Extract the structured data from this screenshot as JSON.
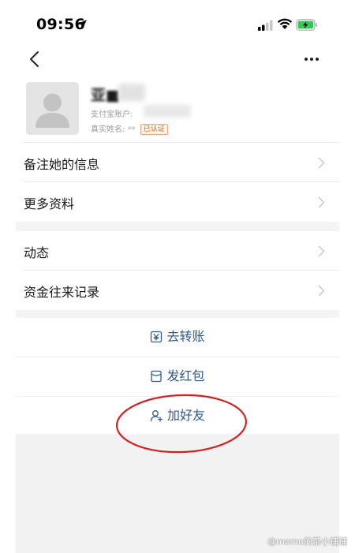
{
  "status_bar": {
    "time": "09:56"
  },
  "profile": {
    "name": "亚■",
    "account_label": "支付宝账户:",
    "realname_label": "真实姓名:",
    "realname_masked": "**",
    "verified_badge": "已认证"
  },
  "list_group_1": [
    {
      "label": "备注她的信息"
    },
    {
      "label": "更多资料"
    }
  ],
  "list_group_2": [
    {
      "label": "动态"
    },
    {
      "label": "资金往来记录"
    }
  ],
  "actions": {
    "transfer": "去转账",
    "red_packet": "发红包",
    "add_friend": "加好友"
  },
  "icons": {
    "transfer": "yuan-transfer-icon",
    "red_packet": "red-packet-icon",
    "add_friend": "add-person-icon"
  },
  "colors": {
    "action_text": "#2f5b8f",
    "badge_orange": "#e8611a",
    "annotation_red": "#d42020",
    "battery_green": "#34c759"
  },
  "watermark": "@momo的茶小铺铺"
}
